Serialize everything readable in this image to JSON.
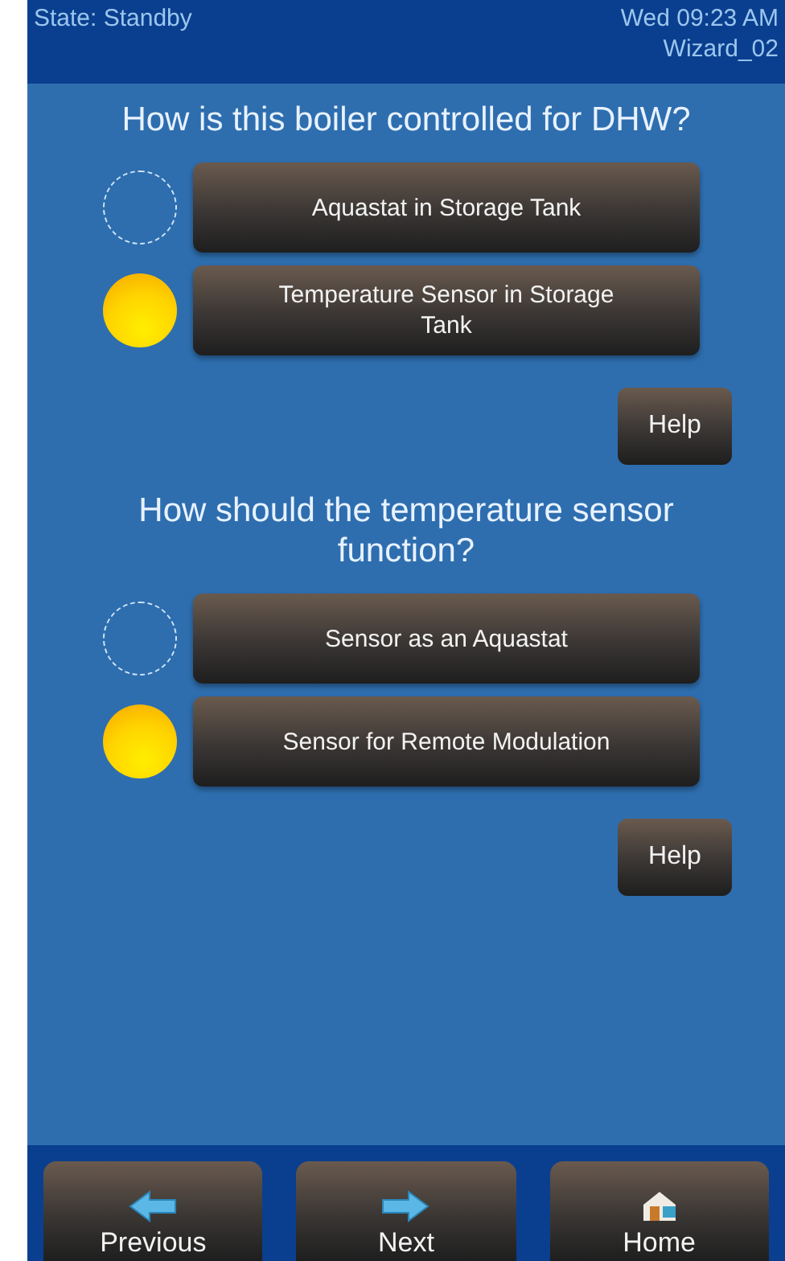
{
  "status_bar": {
    "state": "State: Standby",
    "clock": "Wed 09:23 AM",
    "screen": "Wizard_02"
  },
  "questions": [
    {
      "title": "How is this boiler controlled for DHW?",
      "options": [
        {
          "label": "Aquastat in Storage Tank",
          "selected": false
        },
        {
          "label": "Temperature Sensor in Storage Tank",
          "selected": true
        }
      ],
      "help": "Help"
    },
    {
      "title": "How should the temperature sensor function?",
      "options": [
        {
          "label": "Sensor as an Aquastat",
          "selected": false
        },
        {
          "label": "Sensor for Remote Modulation",
          "selected": true
        }
      ],
      "help": "Help"
    }
  ],
  "nav": [
    {
      "kind": "previous",
      "label": "Previous"
    },
    {
      "kind": "next",
      "label": "Next"
    },
    {
      "kind": "home",
      "label": "Home"
    }
  ]
}
